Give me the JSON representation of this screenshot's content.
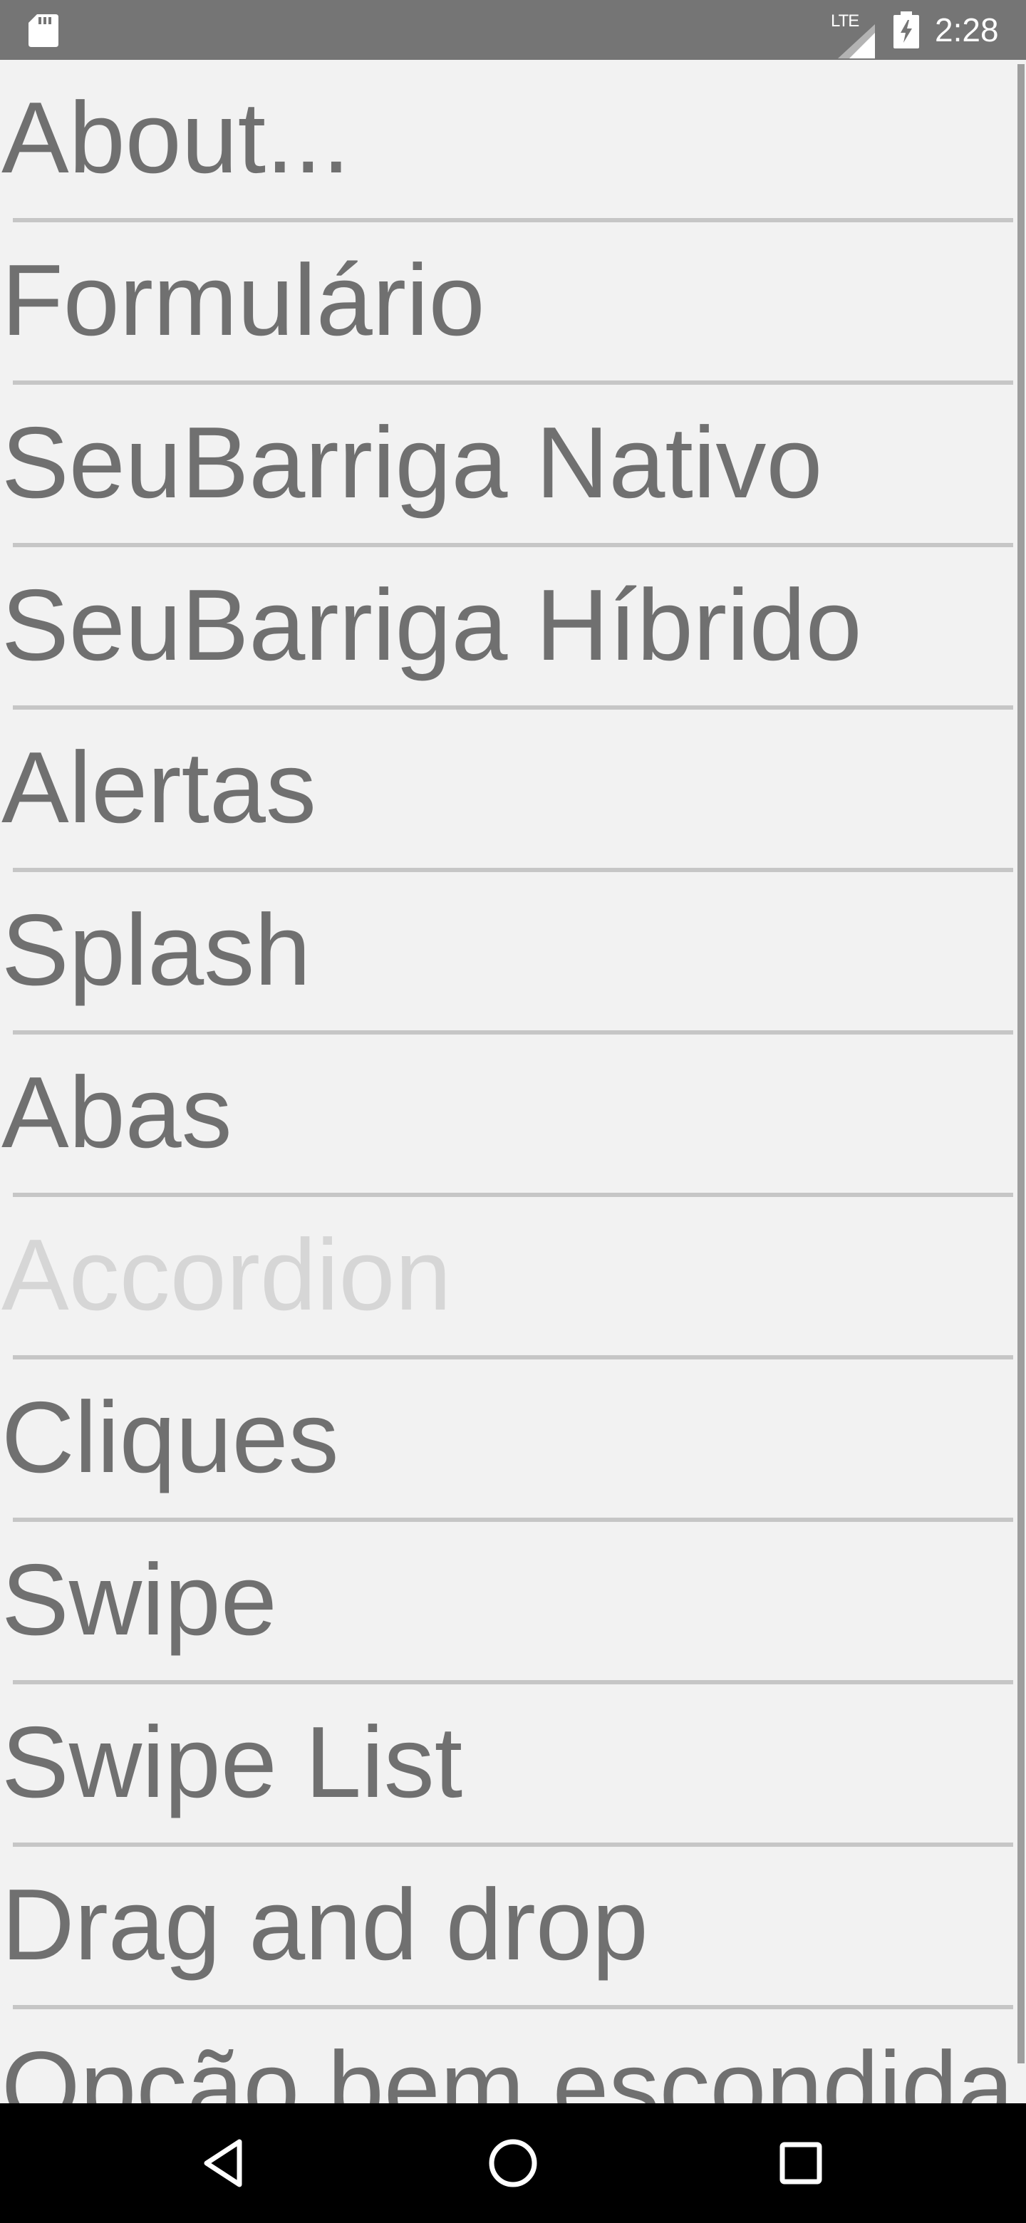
{
  "status_bar": {
    "network": "LTE",
    "time": "2:28"
  },
  "menu": {
    "items": [
      {
        "label": "About...",
        "enabled": true
      },
      {
        "label": "Formulário",
        "enabled": true
      },
      {
        "label": "SeuBarriga Nativo",
        "enabled": true
      },
      {
        "label": "SeuBarriga Híbrido",
        "enabled": true
      },
      {
        "label": "Alertas",
        "enabled": true
      },
      {
        "label": "Splash",
        "enabled": true
      },
      {
        "label": "Abas",
        "enabled": true
      },
      {
        "label": "Accordion",
        "enabled": false
      },
      {
        "label": "Cliques",
        "enabled": true
      },
      {
        "label": "Swipe",
        "enabled": true
      },
      {
        "label": "Swipe List",
        "enabled": true
      },
      {
        "label": "Drag and drop",
        "enabled": true
      },
      {
        "label": "Opção bem escondida",
        "enabled": true
      }
    ]
  },
  "nav_bar": {
    "buttons": [
      "back-icon",
      "home-icon",
      "recents-icon"
    ]
  },
  "colors": {
    "status_bar": "#757575",
    "background": "#f2f2f2",
    "text": "#707070",
    "disabled_text": "#d6d6d6",
    "divider": "#c6c6c6",
    "nav_bar": "#000000"
  }
}
